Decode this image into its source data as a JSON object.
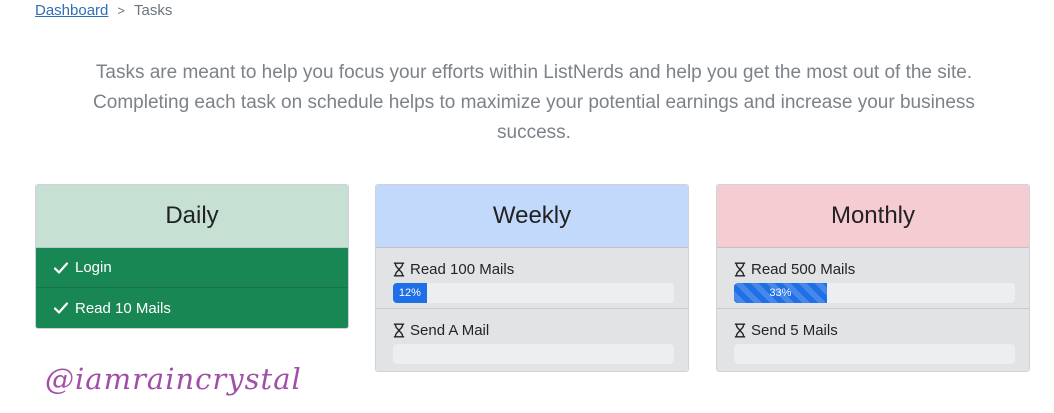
{
  "breadcrumb": {
    "home": "Dashboard",
    "separator": ">",
    "current": "Tasks"
  },
  "intro": "Tasks are meant to help you focus your efforts within ListNerds and help you get the most out of the site. Completing each task on schedule helps to maximize your potential earnings and increase your business success.",
  "daily": {
    "title": "Daily",
    "items": [
      {
        "label": "Login",
        "icon": "check-icon"
      },
      {
        "label": "Read 10 Mails",
        "icon": "check-icon"
      }
    ]
  },
  "weekly": {
    "title": "Weekly",
    "items": [
      {
        "label": "Read 100 Mails",
        "icon": "hourglass-icon",
        "progress_text": "12%",
        "progress": 0.12
      },
      {
        "label": "Send A Mail",
        "icon": "hourglass-icon",
        "progress_text": "",
        "progress": 0
      }
    ]
  },
  "monthly": {
    "title": "Monthly",
    "items": [
      {
        "label": "Read 500 Mails",
        "icon": "hourglass-icon",
        "progress_text": "33%",
        "progress": 0.33
      },
      {
        "label": "Send 5 Mails",
        "icon": "hourglass-icon",
        "progress_text": "",
        "progress": 0
      }
    ]
  },
  "watermark": "@iamraincrystal",
  "colors": {
    "link": "#2f6fb6",
    "success": "#198754",
    "progress": "#1f6fe6",
    "daily_header": "#c6e0d3",
    "weekly_header": "#c2d9fb",
    "monthly_header": "#f5ccd1",
    "watermark": "#a04fa8"
  }
}
